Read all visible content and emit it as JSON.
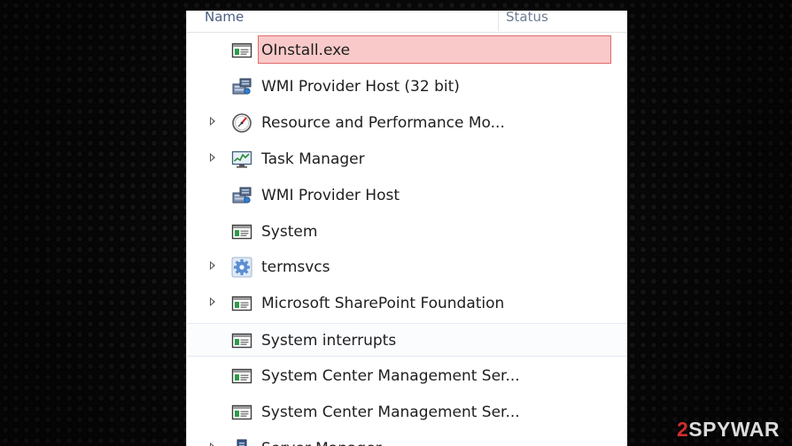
{
  "header": {
    "name_label": "Name",
    "status_label": "Status"
  },
  "processes": [
    {
      "name": "OInstall.exe",
      "icon": "app-window-icon",
      "expandable": false,
      "highlight": "flagged"
    },
    {
      "name": "WMI Provider Host (32 bit)",
      "icon": "wmi-host-icon",
      "expandable": false,
      "highlight": "none"
    },
    {
      "name": "Resource and Performance Mo...",
      "icon": "performance-monitor-icon",
      "expandable": true,
      "highlight": "none"
    },
    {
      "name": "Task Manager",
      "icon": "task-manager-icon",
      "expandable": true,
      "highlight": "none"
    },
    {
      "name": "WMI Provider Host",
      "icon": "wmi-host-icon",
      "expandable": false,
      "highlight": "none"
    },
    {
      "name": "System",
      "icon": "app-window-icon",
      "expandable": false,
      "highlight": "none"
    },
    {
      "name": "termsvcs",
      "icon": "service-gear-icon",
      "expandable": true,
      "highlight": "none"
    },
    {
      "name": "Microsoft SharePoint Foundation",
      "icon": "app-window-icon",
      "expandable": true,
      "highlight": "none"
    },
    {
      "name": "System interrupts",
      "icon": "app-window-icon",
      "expandable": false,
      "highlight": "hover"
    },
    {
      "name": "System Center Management Ser...",
      "icon": "app-window-icon",
      "expandable": false,
      "highlight": "none"
    },
    {
      "name": "System Center Management Ser...",
      "icon": "app-window-icon",
      "expandable": false,
      "highlight": "none"
    },
    {
      "name": "Server Manager",
      "icon": "server-manager-icon",
      "expandable": true,
      "highlight": "none"
    }
  ],
  "watermark": {
    "accent": "2",
    "text": "SPYWAR"
  },
  "colors": {
    "flag_fill": "#f9c9c9",
    "flag_border": "#e56b6b",
    "header_text": "#4d6082"
  }
}
